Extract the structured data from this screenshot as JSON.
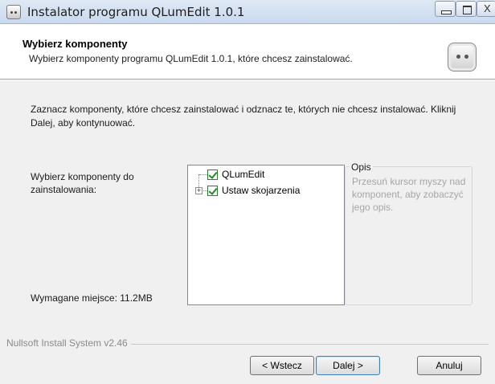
{
  "window": {
    "title": "Instalator programu QLumEdit 1.0.1",
    "close_glyph": "X"
  },
  "header": {
    "title": "Wybierz komponenty",
    "subtitle": "Wybierz komponenty programu QLumEdit 1.0.1, które chcesz zainstalować.",
    "icon": "installer-icon"
  },
  "main": {
    "intro": "Zaznacz komponenty, które chcesz zainstalować i odznacz te, których nie chcesz instalować. Kliknij Dalej, aby kontynuować.",
    "select_label": "Wybierz komponenty do zainstalowania:",
    "space_required": "Wymagane miejsce: 11.2MB",
    "components": [
      {
        "label": "QLumEdit",
        "checked": true,
        "expandable": false
      },
      {
        "label": "Ustaw skojarzenia",
        "checked": true,
        "expandable": true,
        "expander_glyph": "+"
      }
    ],
    "description": {
      "title": "Opis",
      "text": "Przesuń kursor myszy nad komponent, aby zobaczyć jego opis."
    }
  },
  "footer": {
    "branding": "Nullsoft Install System v2.46",
    "back_label": "< Wstecz",
    "next_label": "Dalej >",
    "cancel_label": "Anuluj"
  },
  "colors": {
    "titlebar": "#c9d9ee",
    "body_bg": "#f0f0f0",
    "checkbox_check": "#1e8d1e",
    "description_text": "#a6a6a6"
  }
}
